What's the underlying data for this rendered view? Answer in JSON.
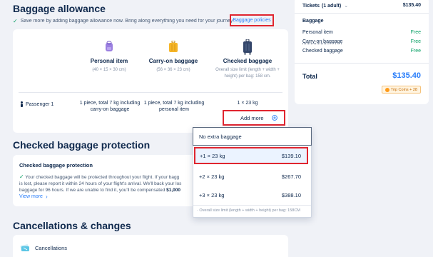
{
  "baggage": {
    "title": "Baggage allowance",
    "promo_text": "Save more by adding baggage allowance now. Bring along everything you need for your journey",
    "policies_link": "Baggage policies",
    "columns": [
      {
        "title": "Personal item",
        "sub": "(40 × 15 × 30 cm)"
      },
      {
        "title": "Carry-on baggage",
        "sub": "(56 × 36 × 23 cm)"
      },
      {
        "title": "Checked baggage",
        "sub": "Overall size limit (length + width + height) per bag: 158 cm."
      }
    ],
    "passenger_label": "Passenger 1",
    "personal_item_value": "1 piece, total 7 kg including carry-on baggage",
    "carry_on_value": "1 piece, total 7 kg including personal item",
    "checked_value": "1 × 23 kg",
    "add_more": "Add more"
  },
  "protection": {
    "title": "Checked baggage protection",
    "card_title": "Checked baggage protection",
    "line1": "Your checked baggage will be protected throughout your flight. If your bagg",
    "line2": "is lost, please report it within 24 hours of your flight's arrival. We'll back your los",
    "line3_prefix": "baggage for 96 hours. If we are unable to find it, you'll be compensated ",
    "line3_amount": "$1,000",
    "view_more": "View more"
  },
  "cancellations": {
    "title": "Cancellations & changes",
    "item_label": "Cancellations"
  },
  "dropdown": {
    "options": [
      {
        "label": "No extra baggage",
        "price": ""
      },
      {
        "label": "+1 × 23 kg",
        "price": "$139.10"
      },
      {
        "label": "+2 × 23 kg",
        "price": "$267.70"
      },
      {
        "label": "+3 × 23 kg",
        "price": "$388.10"
      }
    ],
    "footnote": "· Overall size limit (length + width + height) per bag: 158CM"
  },
  "summary": {
    "tickets_label": "Tickets",
    "tickets_count": "(1 adult)",
    "tickets_price": "$135.40",
    "baggage_heading": "Baggage",
    "rows": [
      {
        "label": "Personal item",
        "value": "Free"
      },
      {
        "label": "Carry-on baggage",
        "value": "Free"
      },
      {
        "label": "Checked baggage",
        "value": "Free"
      }
    ],
    "total_label": "Total",
    "total_value": "$135.40",
    "trip_coins": "Trip Coins + 28"
  },
  "colors": {
    "accent": "#287dfa",
    "free_green": "#0aa066",
    "highlight_red": "#e0252f",
    "selected_row": "#ebf3ff"
  }
}
